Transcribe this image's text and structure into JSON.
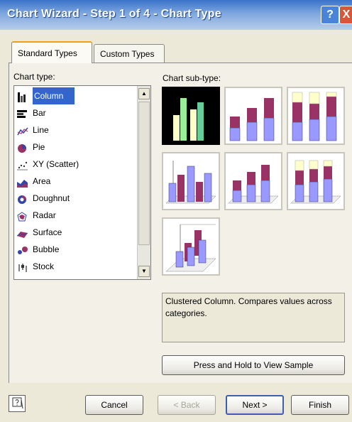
{
  "window": {
    "title": "Chart Wizard - Step 1 of 4 - Chart Type",
    "help_button": "?",
    "close_button": "X"
  },
  "tabs": [
    {
      "label": "Standard Types",
      "active": true
    },
    {
      "label": "Custom Types",
      "active": false
    }
  ],
  "chart_type": {
    "label": "Chart type:",
    "selected": "Column",
    "items": [
      {
        "label": "Column",
        "icon": "column-chart-icon"
      },
      {
        "label": "Bar",
        "icon": "bar-chart-icon"
      },
      {
        "label": "Line",
        "icon": "line-chart-icon"
      },
      {
        "label": "Pie",
        "icon": "pie-chart-icon"
      },
      {
        "label": "XY (Scatter)",
        "icon": "scatter-chart-icon"
      },
      {
        "label": "Area",
        "icon": "area-chart-icon"
      },
      {
        "label": "Doughnut",
        "icon": "doughnut-chart-icon"
      },
      {
        "label": "Radar",
        "icon": "radar-chart-icon"
      },
      {
        "label": "Surface",
        "icon": "surface-chart-icon"
      },
      {
        "label": "Bubble",
        "icon": "bubble-chart-icon"
      },
      {
        "label": "Stock",
        "icon": "stock-chart-icon"
      }
    ]
  },
  "chart_subtype": {
    "label": "Chart sub-type:",
    "selected_index": 0,
    "description": "Clustered Column. Compares values across categories."
  },
  "buttons": {
    "sample": "Press and Hold to View Sample",
    "cancel": "Cancel",
    "back": "< Back",
    "next": "Next >",
    "finish": "Finish"
  },
  "colors": {
    "title_bar": "#3a73c9",
    "selection": "#3366cc",
    "series_purple": "#9999ff",
    "series_maroon": "#993366",
    "series_cream": "#ffffcc"
  }
}
